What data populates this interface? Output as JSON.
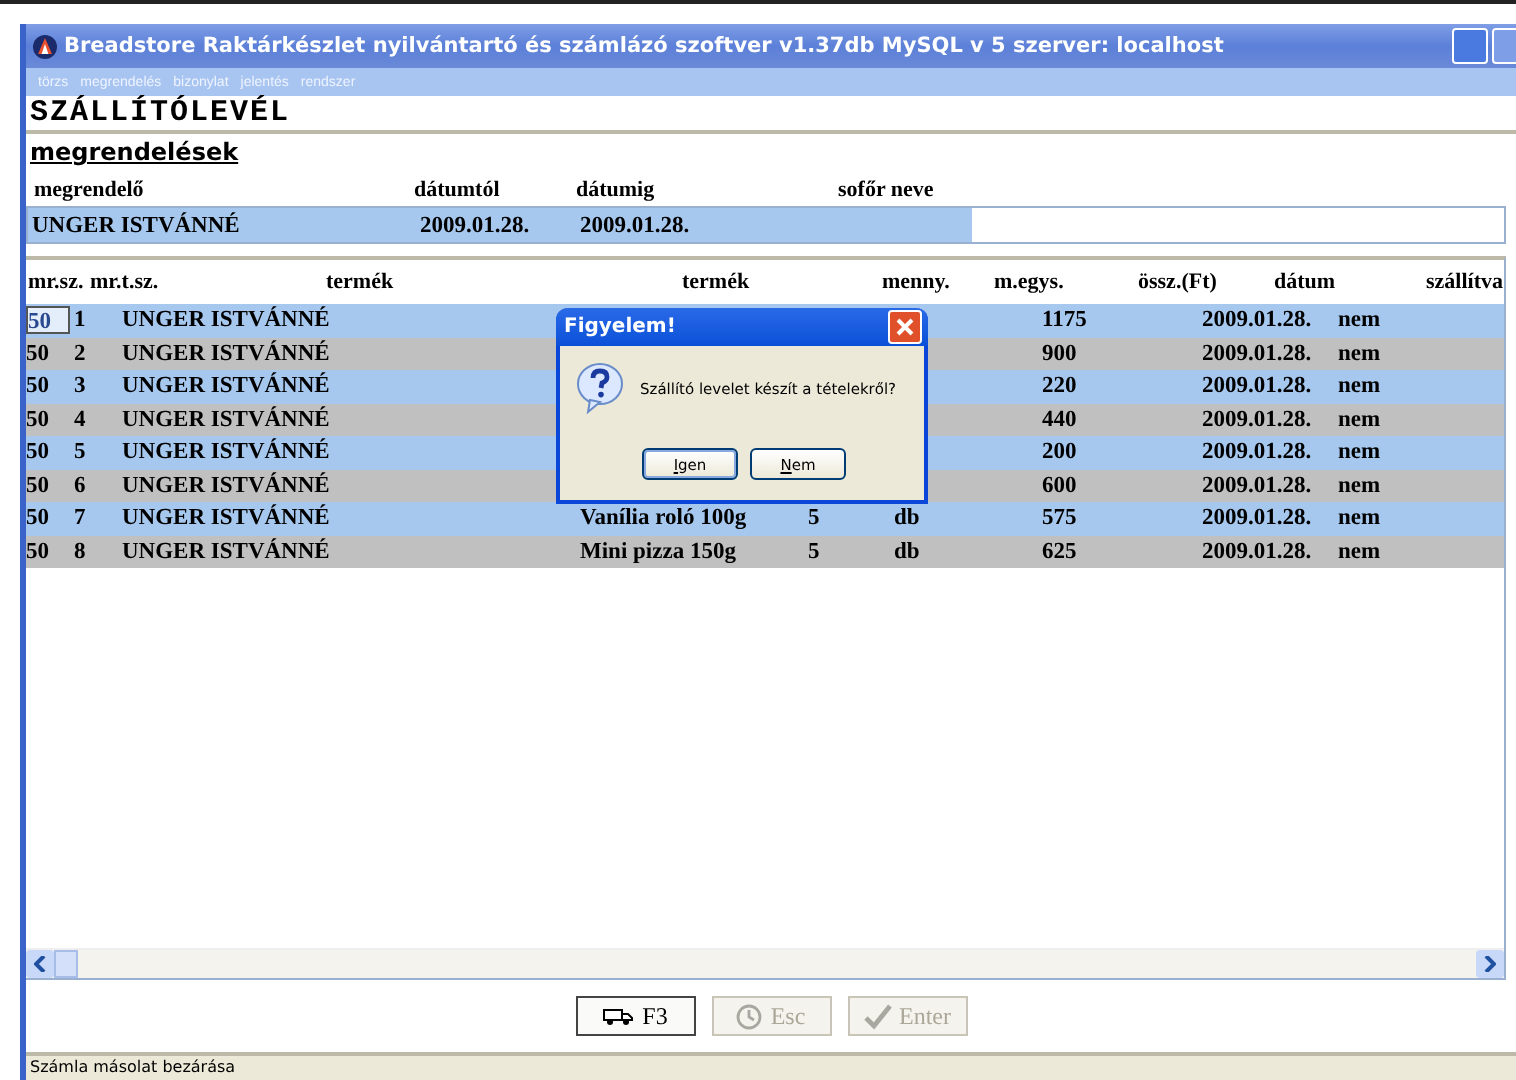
{
  "window": {
    "title": "Breadstore Raktárkészlet nyilvántartó és számlázó szoftver v1.37db MySQL v 5   szerver: localhost"
  },
  "menu": [
    "törzs",
    "megrendelés",
    "bizonylat",
    "jelentés",
    "rendszer"
  ],
  "heading": "SZÁLLÍTÓLEVÉL",
  "subheading": "megrendelések",
  "order": {
    "labels": [
      "megrendelő",
      "dátumtól",
      "dátumig",
      "sofőr neve"
    ],
    "customer": "UNGER ISTVÁNNÉ",
    "date_from": "2009.01.28.",
    "date_to": "2009.01.28."
  },
  "table": {
    "columns": [
      "mr.sz.",
      "mr.t.sz.",
      "termék",
      "termék",
      "menny.",
      "m.egys.",
      "össz.(Ft)",
      "dátum",
      "szállítva"
    ],
    "rows": [
      {
        "order_no": "50",
        "item_no": "1",
        "customer": "UNGER ISTVÁNNÉ",
        "total": "1175",
        "date": "2009.01.28.",
        "shipped": "nem",
        "focused": true
      },
      {
        "order_no": "50",
        "item_no": "2",
        "customer": "UNGER ISTVÁNNÉ",
        "total": "900",
        "date": "2009.01.28.",
        "shipped": "nem",
        "focused": false
      },
      {
        "order_no": "50",
        "item_no": "3",
        "customer": "UNGER ISTVÁNNÉ",
        "total": "220",
        "date": "2009.01.28.",
        "shipped": "nem",
        "focused": false
      },
      {
        "order_no": "50",
        "item_no": "4",
        "customer": "UNGER ISTVÁNNÉ",
        "total": "440",
        "date": "2009.01.28.",
        "shipped": "nem",
        "focused": false
      },
      {
        "order_no": "50",
        "item_no": "5",
        "customer": "UNGER ISTVÁNNÉ",
        "total": "200",
        "date": "2009.01.28.",
        "shipped": "nem",
        "focused": false
      },
      {
        "order_no": "50",
        "item_no": "6",
        "customer": "UNGER ISTVÁNNÉ",
        "total": "600",
        "date": "2009.01.28.",
        "shipped": "nem",
        "focused": false
      },
      {
        "order_no": "50",
        "item_no": "7",
        "customer": "UNGER ISTVÁNNÉ",
        "product": "Vanília roló 100g",
        "qty": "5",
        "unit": "db",
        "total": "575",
        "date": "2009.01.28.",
        "shipped": "nem",
        "focused": false
      },
      {
        "order_no": "50",
        "item_no": "8",
        "customer": "UNGER ISTVÁNNÉ",
        "product": "Mini pizza 150g",
        "qty": "5",
        "unit": "db",
        "total": "625",
        "date": "2009.01.28.",
        "shipped": "nem",
        "focused": false
      }
    ]
  },
  "dialog": {
    "title": "Figyelem!",
    "message": "Szállító levelet készít a tételekről?",
    "buttons": [
      "Igen",
      "Nem"
    ]
  },
  "buttons": [
    {
      "label": "F3",
      "kind": "van",
      "disabled": false
    },
    {
      "label": "Esc",
      "kind": "clock",
      "disabled": true
    },
    {
      "label": "Enter",
      "kind": "check",
      "disabled": true
    }
  ],
  "status_bar": "Számla másolat bezárása"
}
